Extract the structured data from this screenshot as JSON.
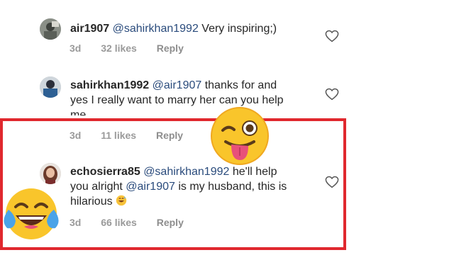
{
  "comments": [
    {
      "username": "air1907",
      "mention": "@sahirkhan1992",
      "text": " Very inspiring;)",
      "time": "3d",
      "likes": "32 likes",
      "reply": "Reply"
    },
    {
      "username": "sahirkhan1992",
      "mention": "@air1907",
      "text_line1": " thanks for and",
      "text_line2": "yes I really want to marry her can you help",
      "text_line3": "me",
      "time": "3d",
      "likes": "11 likes",
      "reply": "Reply"
    },
    {
      "username": "echosierra85",
      "mention": "@sahirkhan1992",
      "text_line1_end": " he'll help",
      "text_line2_start": "you alright ",
      "mention2": "@air1907",
      "text_line2_end": " is my husband, this is",
      "text_line3": "hilarious ",
      "time": "3d",
      "likes": "66 likes",
      "reply": "Reply"
    }
  ],
  "colors": {
    "highlight_border": "#e0282e",
    "mention": "#2a4b7c",
    "meta": "#9a9a9a"
  },
  "icons": [
    "heart-icon",
    "winking-tongue-emoji",
    "tears-of-joy-emoji",
    "grinning-sweat-emoji"
  ]
}
